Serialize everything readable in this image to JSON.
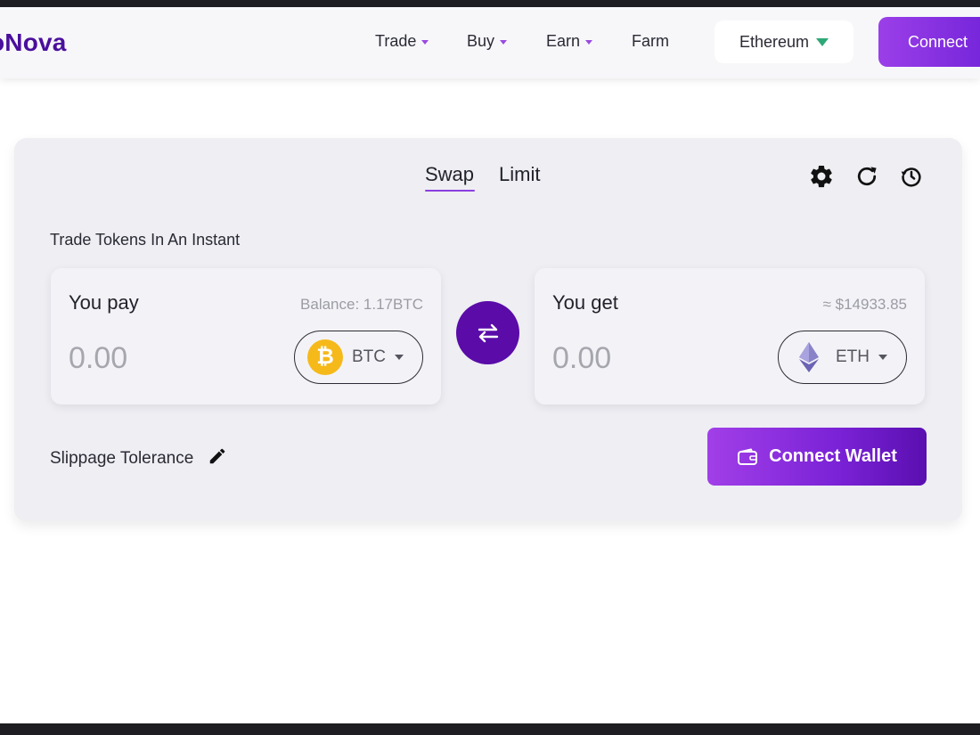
{
  "header": {
    "logo_text": "oNova",
    "nav": [
      {
        "label": "Trade",
        "has_dropdown": true
      },
      {
        "label": "Buy",
        "has_dropdown": true
      },
      {
        "label": "Earn",
        "has_dropdown": true
      },
      {
        "label": "Farm",
        "has_dropdown": false
      }
    ],
    "network_label": "Ethereum",
    "connect_label": "Connect"
  },
  "swap": {
    "tabs": [
      {
        "label": "Swap",
        "active": true
      },
      {
        "label": "Limit",
        "active": false
      }
    ],
    "tools": [
      "gear-icon",
      "refresh-icon",
      "history-icon"
    ],
    "subtitle": "Trade Tokens In An Instant",
    "pay": {
      "label": "You pay",
      "balance": "Balance: 1.17BTC",
      "amount": "0.00",
      "token": "BTC"
    },
    "get": {
      "label": "You get",
      "estimate": "≈ $14933.85",
      "amount": "0.00",
      "token": "ETH"
    },
    "slippage_label": "Slippage Tolerance",
    "connect_wallet_label": "Connect Wallet"
  },
  "colors": {
    "brand_purple": "#5a0ba8",
    "accent_purple": "#9b3fe8",
    "network_green": "#2fa877",
    "btc_yellow": "#f6b91a"
  }
}
